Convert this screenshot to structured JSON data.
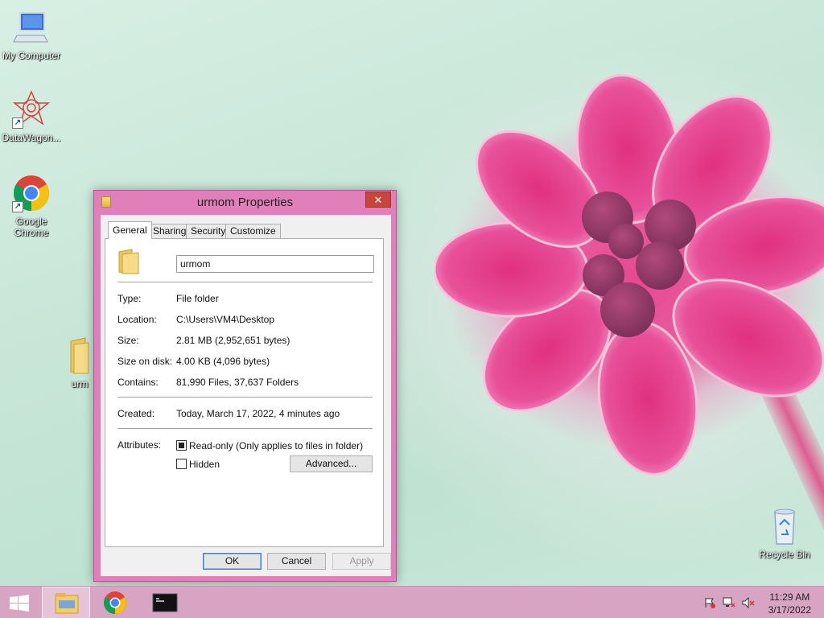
{
  "desktop": {
    "icons": [
      {
        "label": "My Computer",
        "icon": "computer-icon"
      },
      {
        "label": "DataWagon...",
        "icon": "datawagon-icon"
      },
      {
        "label": "Google Chrome",
        "icon": "chrome-icon"
      },
      {
        "label": "urm",
        "icon": "folder-icon"
      },
      {
        "label": "Recycle Bin",
        "icon": "recycle-bin-icon"
      }
    ]
  },
  "dialog": {
    "title": "urmom Properties",
    "close_label": "✕",
    "tabs": [
      {
        "label": "General",
        "active": true
      },
      {
        "label": "Sharing",
        "active": false
      },
      {
        "label": "Security",
        "active": false
      },
      {
        "label": "Customize",
        "active": false
      }
    ],
    "name_value": "urmom",
    "fields": {
      "type": {
        "label": "Type:",
        "value": "File folder"
      },
      "location": {
        "label": "Location:",
        "value": "C:\\Users\\VM4\\Desktop"
      },
      "size": {
        "label": "Size:",
        "value": "2.81 MB (2,952,651 bytes)"
      },
      "size_on_disk": {
        "label": "Size on disk:",
        "value": "4.00 KB (4,096 bytes)"
      },
      "contains": {
        "label": "Contains:",
        "value": "81,990 Files, 37,637 Folders"
      },
      "created": {
        "label": "Created:",
        "value": "Today, March 17, 2022, 4 minutes ago"
      }
    },
    "attributes": {
      "label": "Attributes:",
      "readonly_label": "Read-only (Only applies to files in folder)",
      "readonly_state": "indeterminate",
      "hidden_label": "Hidden",
      "hidden_checked": false,
      "advanced_label": "Advanced..."
    },
    "buttons": {
      "ok": "OK",
      "cancel": "Cancel",
      "apply": "Apply"
    }
  },
  "taskbar": {
    "items": [
      "file-explorer-icon",
      "chrome-icon",
      "command-prompt-icon"
    ],
    "tray": [
      "action-center-flag-icon",
      "network-icon",
      "volume-muted-icon"
    ],
    "time": "11:29 AM",
    "date": "3/17/2022"
  },
  "colors": {
    "dialog_frame": "#e07fb9",
    "taskbar": "#d8a4c4",
    "close_button": "#c7453a",
    "flower": "#e8458f"
  }
}
